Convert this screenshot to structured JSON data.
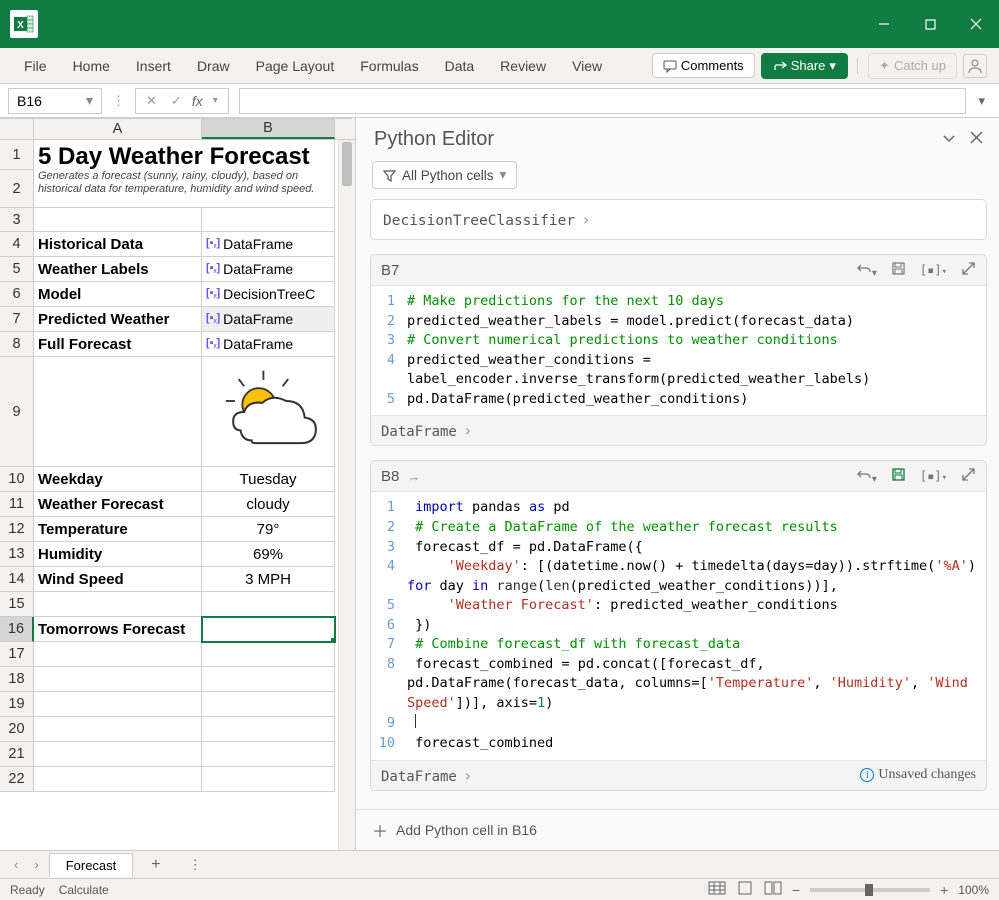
{
  "titlebar": {
    "logo": "X"
  },
  "ribbon": {
    "tabs": [
      "File",
      "Home",
      "Insert",
      "Draw",
      "Page Layout",
      "Formulas",
      "Data",
      "Review",
      "View"
    ],
    "comments": "Comments",
    "share": "Share",
    "catchup": "Catch up"
  },
  "formulabar": {
    "name_box": "B16",
    "fx": "fx"
  },
  "columns": [
    "A",
    "B"
  ],
  "grid": {
    "title": "5 Day Weather Forecast",
    "subtitle1": "Generates a forecast (sunny, rainy, cloudy), based on",
    "subtitle2": "historical data for temperature, humidity and wind speed.",
    "rows": [
      {
        "n": "1"
      },
      {
        "n": "2"
      },
      {
        "n": "3"
      },
      {
        "n": "4",
        "a": "Historical Data",
        "b": "DataFrame",
        "py": true
      },
      {
        "n": "5",
        "a": "Weather Labels",
        "b": "DataFrame",
        "py": true
      },
      {
        "n": "6",
        "a": "Model",
        "b": "DecisionTreeC",
        "py": true
      },
      {
        "n": "7",
        "a": "Predicted Weather",
        "b": "DataFrame",
        "py": true,
        "grey": true
      },
      {
        "n": "8",
        "a": "Full Forecast",
        "b": "DataFrame",
        "py": true
      },
      {
        "n": "9"
      },
      {
        "n": "10",
        "a": "Weekday",
        "b": "Tuesday",
        "center": true
      },
      {
        "n": "11",
        "a": "Weather Forecast",
        "b": "cloudy",
        "center": true
      },
      {
        "n": "12",
        "a": "Temperature",
        "b": "79°",
        "center": true
      },
      {
        "n": "13",
        "a": "Humidity",
        "b": "69%",
        "center": true
      },
      {
        "n": "14",
        "a": "Wind Speed",
        "b": "3 MPH",
        "center": true
      },
      {
        "n": "15"
      },
      {
        "n": "16",
        "a": "Tomorrows Forecast",
        "sel": true
      },
      {
        "n": "17"
      },
      {
        "n": "18"
      },
      {
        "n": "19"
      },
      {
        "n": "20"
      },
      {
        "n": "21"
      },
      {
        "n": "22"
      }
    ]
  },
  "py_panel": {
    "title": "Python Editor",
    "filter": "All Python cells",
    "result1": "DecisionTreeClassifier",
    "cellB7": {
      "ref": "B7",
      "output": "DataFrame"
    },
    "cellB8": {
      "ref": "B8",
      "output": "DataFrame",
      "unsaved": "Unsaved changes"
    },
    "add_cell": "Add Python cell in B16"
  },
  "sheet": {
    "name": "Forecast"
  },
  "status": {
    "ready": "Ready",
    "calc": "Calculate",
    "zoom": "100%"
  }
}
